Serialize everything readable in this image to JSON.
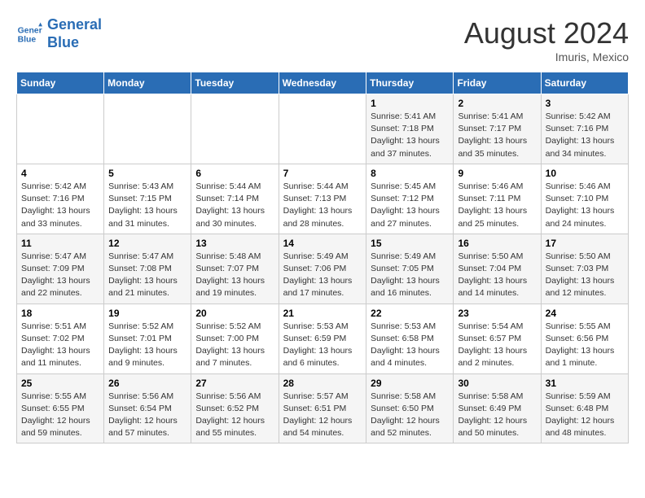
{
  "header": {
    "logo_line1": "General",
    "logo_line2": "Blue",
    "month_year": "August 2024",
    "location": "Imuris, Mexico"
  },
  "days_of_week": [
    "Sunday",
    "Monday",
    "Tuesday",
    "Wednesday",
    "Thursday",
    "Friday",
    "Saturday"
  ],
  "weeks": [
    [
      {
        "day": "",
        "sunrise": "",
        "sunset": "",
        "daylight": ""
      },
      {
        "day": "",
        "sunrise": "",
        "sunset": "",
        "daylight": ""
      },
      {
        "day": "",
        "sunrise": "",
        "sunset": "",
        "daylight": ""
      },
      {
        "day": "",
        "sunrise": "",
        "sunset": "",
        "daylight": ""
      },
      {
        "day": "1",
        "sunrise": "5:41 AM",
        "sunset": "7:18 PM",
        "daylight": "13 hours and 37 minutes."
      },
      {
        "day": "2",
        "sunrise": "5:41 AM",
        "sunset": "7:17 PM",
        "daylight": "13 hours and 35 minutes."
      },
      {
        "day": "3",
        "sunrise": "5:42 AM",
        "sunset": "7:16 PM",
        "daylight": "13 hours and 34 minutes."
      }
    ],
    [
      {
        "day": "4",
        "sunrise": "5:42 AM",
        "sunset": "7:16 PM",
        "daylight": "13 hours and 33 minutes."
      },
      {
        "day": "5",
        "sunrise": "5:43 AM",
        "sunset": "7:15 PM",
        "daylight": "13 hours and 31 minutes."
      },
      {
        "day": "6",
        "sunrise": "5:44 AM",
        "sunset": "7:14 PM",
        "daylight": "13 hours and 30 minutes."
      },
      {
        "day": "7",
        "sunrise": "5:44 AM",
        "sunset": "7:13 PM",
        "daylight": "13 hours and 28 minutes."
      },
      {
        "day": "8",
        "sunrise": "5:45 AM",
        "sunset": "7:12 PM",
        "daylight": "13 hours and 27 minutes."
      },
      {
        "day": "9",
        "sunrise": "5:46 AM",
        "sunset": "7:11 PM",
        "daylight": "13 hours and 25 minutes."
      },
      {
        "day": "10",
        "sunrise": "5:46 AM",
        "sunset": "7:10 PM",
        "daylight": "13 hours and 24 minutes."
      }
    ],
    [
      {
        "day": "11",
        "sunrise": "5:47 AM",
        "sunset": "7:09 PM",
        "daylight": "13 hours and 22 minutes."
      },
      {
        "day": "12",
        "sunrise": "5:47 AM",
        "sunset": "7:08 PM",
        "daylight": "13 hours and 21 minutes."
      },
      {
        "day": "13",
        "sunrise": "5:48 AM",
        "sunset": "7:07 PM",
        "daylight": "13 hours and 19 minutes."
      },
      {
        "day": "14",
        "sunrise": "5:49 AM",
        "sunset": "7:06 PM",
        "daylight": "13 hours and 17 minutes."
      },
      {
        "day": "15",
        "sunrise": "5:49 AM",
        "sunset": "7:05 PM",
        "daylight": "13 hours and 16 minutes."
      },
      {
        "day": "16",
        "sunrise": "5:50 AM",
        "sunset": "7:04 PM",
        "daylight": "13 hours and 14 minutes."
      },
      {
        "day": "17",
        "sunrise": "5:50 AM",
        "sunset": "7:03 PM",
        "daylight": "13 hours and 12 minutes."
      }
    ],
    [
      {
        "day": "18",
        "sunrise": "5:51 AM",
        "sunset": "7:02 PM",
        "daylight": "13 hours and 11 minutes."
      },
      {
        "day": "19",
        "sunrise": "5:52 AM",
        "sunset": "7:01 PM",
        "daylight": "13 hours and 9 minutes."
      },
      {
        "day": "20",
        "sunrise": "5:52 AM",
        "sunset": "7:00 PM",
        "daylight": "13 hours and 7 minutes."
      },
      {
        "day": "21",
        "sunrise": "5:53 AM",
        "sunset": "6:59 PM",
        "daylight": "13 hours and 6 minutes."
      },
      {
        "day": "22",
        "sunrise": "5:53 AM",
        "sunset": "6:58 PM",
        "daylight": "13 hours and 4 minutes."
      },
      {
        "day": "23",
        "sunrise": "5:54 AM",
        "sunset": "6:57 PM",
        "daylight": "13 hours and 2 minutes."
      },
      {
        "day": "24",
        "sunrise": "5:55 AM",
        "sunset": "6:56 PM",
        "daylight": "13 hours and 1 minute."
      }
    ],
    [
      {
        "day": "25",
        "sunrise": "5:55 AM",
        "sunset": "6:55 PM",
        "daylight": "12 hours and 59 minutes."
      },
      {
        "day": "26",
        "sunrise": "5:56 AM",
        "sunset": "6:54 PM",
        "daylight": "12 hours and 57 minutes."
      },
      {
        "day": "27",
        "sunrise": "5:56 AM",
        "sunset": "6:52 PM",
        "daylight": "12 hours and 55 minutes."
      },
      {
        "day": "28",
        "sunrise": "5:57 AM",
        "sunset": "6:51 PM",
        "daylight": "12 hours and 54 minutes."
      },
      {
        "day": "29",
        "sunrise": "5:58 AM",
        "sunset": "6:50 PM",
        "daylight": "12 hours and 52 minutes."
      },
      {
        "day": "30",
        "sunrise": "5:58 AM",
        "sunset": "6:49 PM",
        "daylight": "12 hours and 50 minutes."
      },
      {
        "day": "31",
        "sunrise": "5:59 AM",
        "sunset": "6:48 PM",
        "daylight": "12 hours and 48 minutes."
      }
    ]
  ]
}
